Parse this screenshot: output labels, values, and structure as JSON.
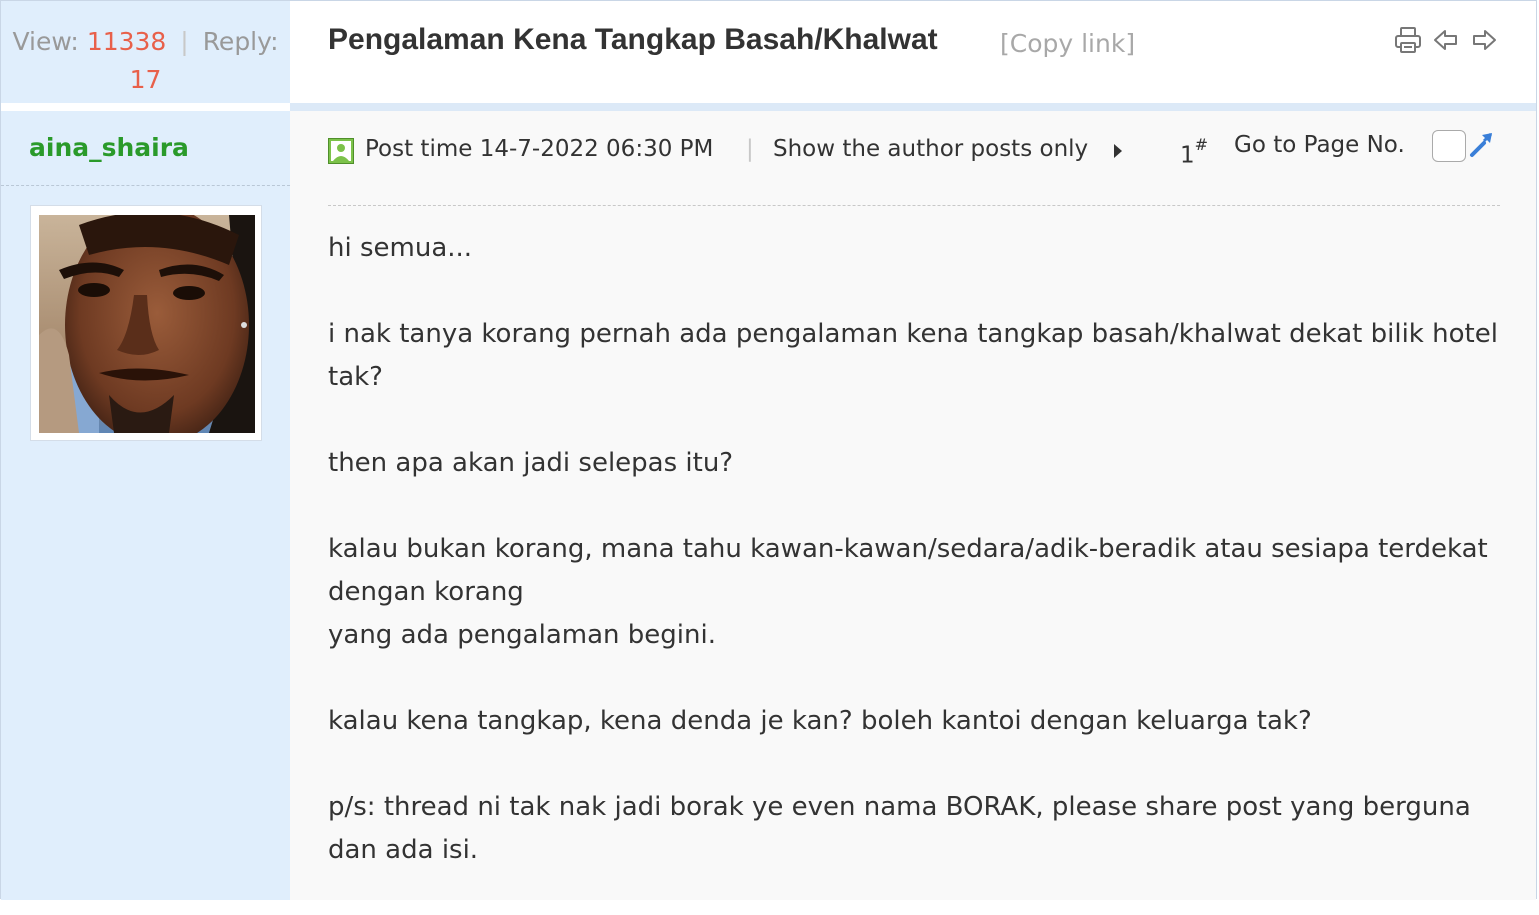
{
  "thread": {
    "view_label": "View:",
    "view_count": "11338",
    "stats_separator": "|",
    "reply_label": "Reply:",
    "reply_count": "17",
    "title": "Pengalaman Kena Tangkap Basah/Khalwat",
    "copy_link": "[Copy link]",
    "header_icons": [
      "print-icon",
      "previous-thread-icon",
      "next-thread-icon"
    ]
  },
  "post": {
    "author": "aina_shaira",
    "post_time": "Post time 14-7-2022 06:30 PM",
    "meta_separator": "|",
    "author_only": "Show the author posts only",
    "floor_number": "1",
    "floor_suffix": "#",
    "goto_page": "Go to Page No.",
    "paragraphs": [
      [
        "hi semua..."
      ],
      [
        "i nak tanya korang pernah ada pengalaman kena tangkap basah/khalwat dekat bilik hotel tak?"
      ],
      [
        "then apa akan jadi selepas itu?"
      ],
      [
        "kalau bukan korang, mana tahu kawan-kawan/sedara/adik-beradik atau sesiapa terdekat dengan korang",
        "yang ada pengalaman begini."
      ],
      [
        "kalau kena tangkap, kena denda je kan? boleh kantoi dengan keluarga tak?"
      ],
      [
        "p/s: thread ni tak nak jadi borak ye even nama BORAK, please share post yang berguna dan ada isi."
      ]
    ]
  },
  "colors": {
    "sidebar_bg": "#e0eefc",
    "count_red": "#e8604a",
    "author_green": "#2a9a2a",
    "link_blue": "#3a7fd8"
  }
}
